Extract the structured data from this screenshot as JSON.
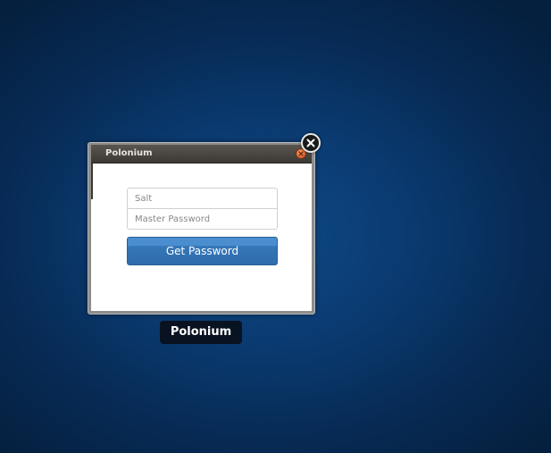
{
  "window": {
    "title": "Polonium",
    "icons": {
      "titlebar_close": "close-icon",
      "expose_close": "close-icon"
    }
  },
  "form": {
    "salt_placeholder": "Salt",
    "salt_value": "",
    "master_password_placeholder": "Master Password",
    "master_password_value": "",
    "submit_label": "Get Password"
  },
  "expose_label": "Polonium",
  "colors": {
    "desktop_background": "#0a3a70",
    "button": "#3577b8",
    "titlebar": "#4a4640",
    "close_accent": "#e0602a"
  }
}
